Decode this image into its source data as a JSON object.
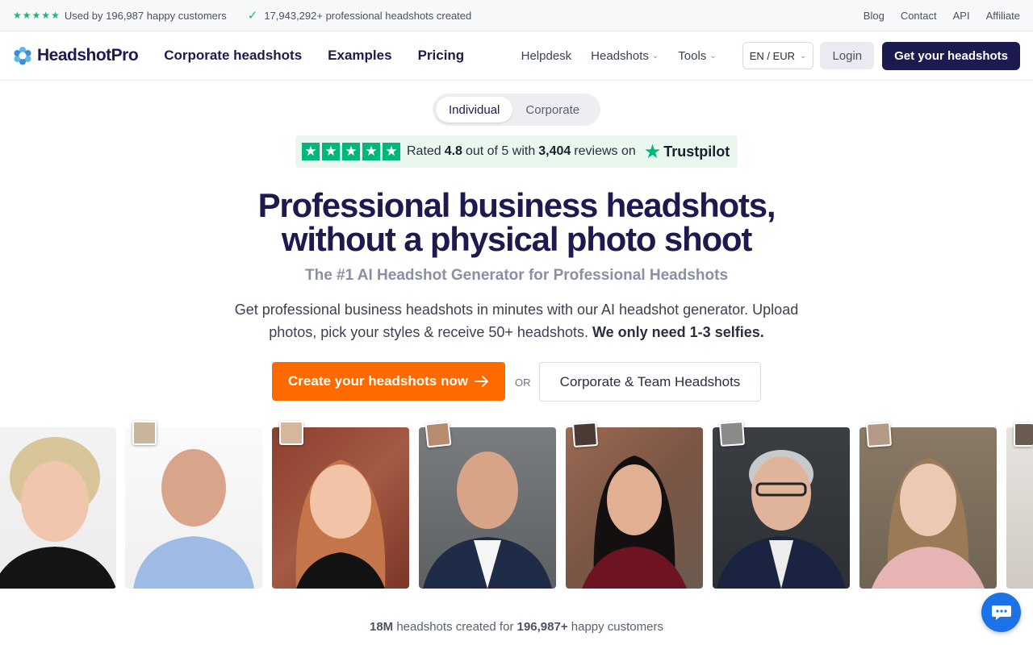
{
  "topbar": {
    "customers_text": "Used by 196,987 happy customers",
    "headshots_text": "17,943,292+ professional headshots created",
    "links": [
      "Blog",
      "Contact",
      "API",
      "Affiliate"
    ]
  },
  "nav": {
    "logo": "HeadshotPro",
    "main_links": [
      "Corporate headshots",
      "Examples",
      "Pricing"
    ],
    "helpdesk": "Helpdesk",
    "headshots": "Headshots",
    "tools": "Tools",
    "language": "EN / EUR",
    "login": "Login",
    "cta": "Get your headshots"
  },
  "toggle": {
    "individual": "Individual",
    "corporate": "Corporate"
  },
  "trustpilot": {
    "rated": "Rated",
    "score": "4.8",
    "out_of": "out of 5 with",
    "reviews_count": "3,404",
    "reviews_on": "reviews on",
    "brand": "Trustpilot",
    "stars": 5
  },
  "hero": {
    "title_line1": "Professional business headshots,",
    "title_line2": "without a physical photo shoot",
    "subtitle": "The #1 AI Headshot Generator for Professional Headshots",
    "description": "Get professional business headshots in minutes with our AI headshot generator. Upload photos, pick your styles & receive 50+ headshots.",
    "description_bold": "We only need 1-3 selfies.",
    "cta_primary": "Create your headshots now",
    "or": "OR",
    "cta_secondary": "Corporate & Team Headshots"
  },
  "gallery": {
    "photos": [
      "headshot-woman-curly-blonde",
      "headshot-man-bald-blue-shirt",
      "headshot-woman-red-hair",
      "headshot-man-navy-suit",
      "headshot-woman-dark-hair",
      "headshot-man-glasses-grey-hair",
      "headshot-woman-light-brown-hair",
      "headshot-partial"
    ]
  },
  "stats": {
    "headshots_count": "18M",
    "mid": "headshots created for",
    "customers_count": "196,987+",
    "end": "happy customers"
  },
  "colors": {
    "brand_dark": "#1c1a4f",
    "accent_orange": "#ff6a00",
    "trust_green": "#00b67a",
    "chat_blue": "#1c73e8"
  }
}
